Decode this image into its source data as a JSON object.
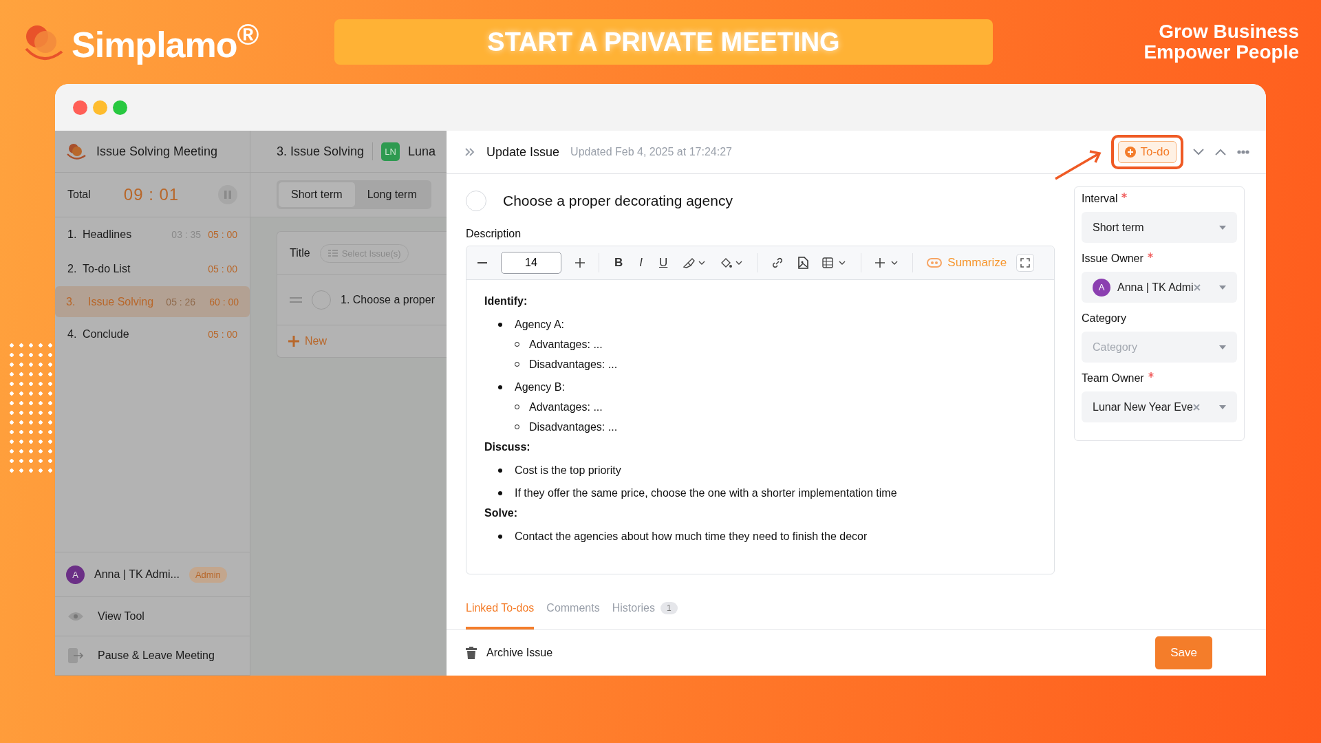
{
  "brand": {
    "logo": "Simplamo$^{®}$",
    "banner": "START A PRIVATE MEETING",
    "tagline": [
      "Grow Business",
      "Empower People"
    ]
  },
  "sidebar": {
    "meeting_title": "Issue Solving Meeting",
    "total_label": "Total",
    "total_time": "09 : 01",
    "agenda": [
      {
        "number": "1.",
        "title": "Headlines",
        "elapsed": "03 : 35",
        "duration": "05 : 00",
        "selected": false
      },
      {
        "number": "2.",
        "title": "To-do List",
        "duration": "05 : 00",
        "selected": false
      },
      {
        "number": "3.",
        "title": "Issue Solving",
        "elapsed": "05 : 26",
        "duration": "60 : 00",
        "selected": true
      },
      {
        "number": "4.",
        "title": "Conclude",
        "duration": "05 : 00",
        "selected": false
      }
    ],
    "user": {
      "avatar": "A",
      "name": "Anna | TK Admi...",
      "role": "Admin"
    },
    "actions": [
      {
        "kind": "view",
        "label": "View Tool"
      },
      {
        "kind": "leave",
        "label": "Pause & Leave Meeting"
      }
    ]
  },
  "middle": {
    "step": "3. Issue Solving",
    "team_badge": "LN",
    "team_name": "Luna",
    "intervals": [
      {
        "label": "Short term",
        "selected": true
      },
      {
        "label": "Long term",
        "selected": false
      }
    ],
    "title_label": "Title",
    "select_button": "Select Issue(s)",
    "rows": [
      "1. Choose a proper"
    ],
    "new_button": "New"
  },
  "drawer": {
    "title": "Update Issue",
    "updated": "Updated Feb 4, 2025 at 17:24:27",
    "status": "To-do",
    "issue_title": "Choose a proper decorating agency",
    "description_label": "Description",
    "toolbar": {
      "font_size": "14",
      "format_buttons": [
        "B",
        "I",
        "U"
      ],
      "summarize": "Summarize"
    },
    "content": [
      {
        "kind": "heading",
        "text": "Identify:"
      },
      {
        "kind": "bullet",
        "text": "Agency A:",
        "children": [
          {
            "text": "Advantages: ..."
          },
          {
            "text": "Disadvantages: ..."
          }
        ]
      },
      {
        "kind": "bullet",
        "text": "Agency B:",
        "children": [
          {
            "text": "Advantages: ..."
          },
          {
            "text": "Disadvantages: ..."
          }
        ]
      },
      {
        "kind": "heading",
        "text": "Discuss:"
      },
      {
        "kind": "bullet",
        "text": "Cost is the top priority"
      },
      {
        "kind": "bullet",
        "text": "If they offer the same price, choose the one with a shorter implementation time"
      },
      {
        "kind": "heading",
        "text": "Solve:"
      },
      {
        "kind": "bullet",
        "text": "Contact the agencies about how much time  they need to finish the decor"
      }
    ],
    "fields": [
      {
        "label": "Interval",
        "required": true,
        "value": "Short term",
        "clearable": false
      },
      {
        "label": "Issue Owner",
        "required": true,
        "value": "Anna | TK Admi",
        "avatar": "A",
        "clearable": true
      },
      {
        "label": "Category",
        "required": false,
        "placeholder": "Category",
        "clearable": false
      },
      {
        "label": "Team Owner",
        "required": true,
        "value": "Lunar New Year Eve",
        "clearable": true
      }
    ],
    "tabs": [
      {
        "label": "Linked To-dos",
        "selected": true
      },
      {
        "label": "Comments",
        "selected": false
      },
      {
        "label": "Histories",
        "count": "1",
        "selected": false
      }
    ],
    "archive": "Archive Issue",
    "save": "Save"
  }
}
